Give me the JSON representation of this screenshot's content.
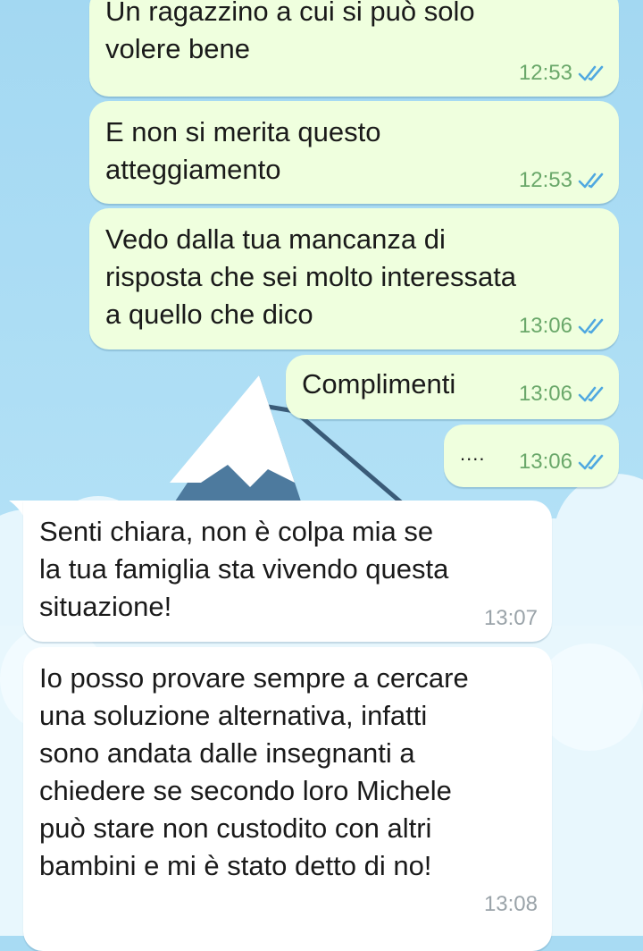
{
  "chat": {
    "messages": [
      {
        "direction": "outgoing",
        "text": "Un ragazzino a cui si può solo\nvolere bene",
        "time": "12:53",
        "status_icon": "double-check-icon"
      },
      {
        "direction": "outgoing",
        "text": "E non si merita questo\natteggiamento",
        "time": "12:53",
        "status_icon": "double-check-icon"
      },
      {
        "direction": "outgoing",
        "text": "Vedo dalla tua mancanza di\nrisposta che sei molto interessata\na quello che dico",
        "time": "13:06",
        "status_icon": "double-check-icon"
      },
      {
        "direction": "outgoing",
        "text": "Complimenti",
        "time": "13:06",
        "status_icon": "double-check-icon"
      },
      {
        "direction": "outgoing",
        "text": "....",
        "time": "13:06",
        "status_icon": "double-check-icon"
      },
      {
        "direction": "incoming",
        "text": "Senti chiara, non è colpa mia se\nla tua famiglia sta vivendo questa\nsituazione!",
        "time": "13:07"
      },
      {
        "direction": "incoming",
        "text": "Io posso provare sempre a cercare\nuna soluzione alternativa, infatti\nsono andata dalle insegnanti a\nchiedere se secondo loro Michele\npuò stare non custodito con altri\nbambini e mi è stato detto di no!",
        "time": "13:08"
      }
    ]
  },
  "colors": {
    "background": "#a8dbf3",
    "outgoing_bubble": "#efffde",
    "incoming_bubble": "#ffffff",
    "outgoing_time": "#6aa86a",
    "incoming_time": "#9aa3a9",
    "check_mark": "#4fa8e0"
  }
}
